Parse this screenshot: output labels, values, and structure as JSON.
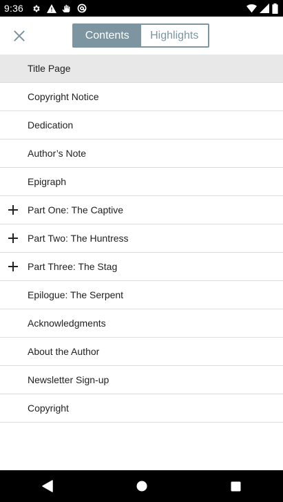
{
  "status_bar": {
    "time": "9:36",
    "left_icons": [
      "settings-gear-icon",
      "warning-triangle-icon",
      "notification-hand-icon",
      "at-sign-icon"
    ],
    "right_icons": [
      "wifi-icon",
      "cellular-signal-icon",
      "battery-icon"
    ]
  },
  "header": {
    "close_icon": "close-x-icon",
    "tabs": [
      {
        "label": "Contents",
        "active": true
      },
      {
        "label": "Highlights",
        "active": false
      }
    ],
    "accent_color": "#7d95a0"
  },
  "toc": {
    "items": [
      {
        "label": "Title Page",
        "expandable": false,
        "selected": true
      },
      {
        "label": "Copyright Notice",
        "expandable": false,
        "selected": false
      },
      {
        "label": "Dedication",
        "expandable": false,
        "selected": false
      },
      {
        "label": "Author’s Note",
        "expandable": false,
        "selected": false
      },
      {
        "label": "Epigraph",
        "expandable": false,
        "selected": false
      },
      {
        "label": "Part One: The Captive",
        "expandable": true,
        "selected": false
      },
      {
        "label": "Part Two: The Huntress",
        "expandable": true,
        "selected": false
      },
      {
        "label": "Part Three: The Stag",
        "expandable": true,
        "selected": false
      },
      {
        "label": "Epilogue: The Serpent",
        "expandable": false,
        "selected": false
      },
      {
        "label": "Acknowledgments",
        "expandable": false,
        "selected": false
      },
      {
        "label": "About the Author",
        "expandable": false,
        "selected": false
      },
      {
        "label": "Newsletter Sign-up",
        "expandable": false,
        "selected": false
      },
      {
        "label": "Copyright",
        "expandable": false,
        "selected": false
      }
    ]
  },
  "nav_bar": {
    "buttons": [
      "back-triangle-icon",
      "home-circle-icon",
      "recents-square-icon"
    ]
  }
}
